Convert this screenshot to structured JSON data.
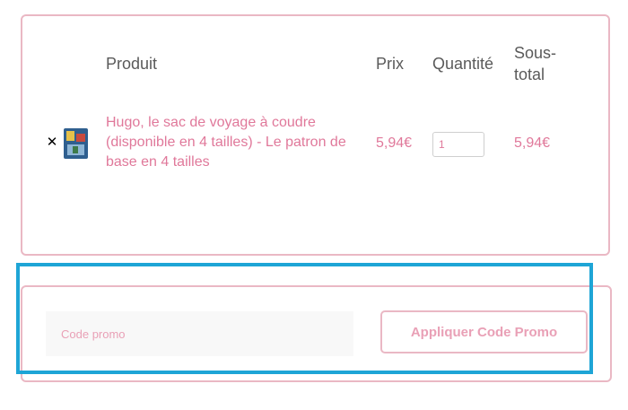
{
  "cart": {
    "headers": {
      "product": "Produit",
      "price": "Prix",
      "quantity": "Quantité",
      "subtotal_line1": "Sous-",
      "subtotal_line2": "total"
    },
    "items": [
      {
        "remove_icon": "close-icon",
        "name": "Hugo, le sac de voyage à coudre (disponible en 4 tailles) - Le patron de base en 4 tailles",
        "price": "5,94€",
        "quantity": "1",
        "subtotal": "5,94€"
      }
    ]
  },
  "coupon": {
    "placeholder": "Code promo",
    "apply_label": "Appliquer Code Promo"
  },
  "colors": {
    "accent_pink": "#e0789a",
    "border_pink": "#eab8c4",
    "highlight_blue": "#1ea5d6"
  }
}
